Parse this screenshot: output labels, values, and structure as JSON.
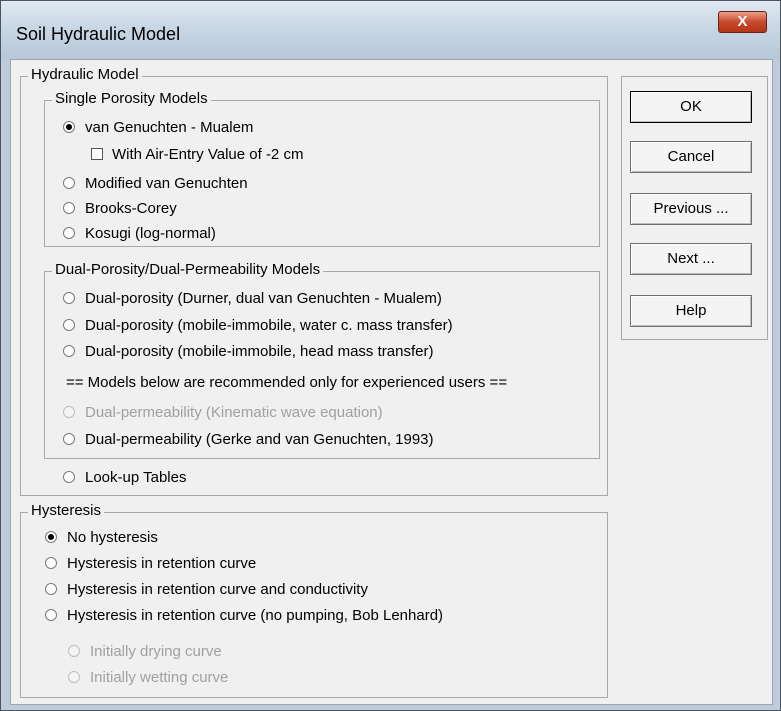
{
  "window": {
    "title": "Soil Hydraulic Model",
    "close_label": "X"
  },
  "hydraulic": {
    "label": "Hydraulic Model",
    "single": {
      "label": "Single Porosity Models",
      "vg": "van Genuchten - Mualem",
      "air_entry": "With Air-Entry Value of -2 cm",
      "modified": "Modified van Genuchten",
      "brooks": "Brooks-Corey",
      "kosugi": "Kosugi (log-normal)"
    },
    "dual": {
      "label": "Dual-Porosity/Dual-Permeability Models",
      "durner": "Dual-porosity (Durner, dual van Genuchten - Mualem)",
      "mim_water": "Dual-porosity (mobile-immobile, water c. mass transfer)",
      "mim_head": "Dual-porosity (mobile-immobile, head mass transfer)",
      "note": "== Models below are recommended only for experienced users ==",
      "kinematic": "Dual-permeability (Kinematic wave equation)",
      "gerke": "Dual-permeability (Gerke and van Genuchten, 1993)"
    },
    "lookup": "Look-up Tables"
  },
  "hysteresis": {
    "label": "Hysteresis",
    "none": "No hysteresis",
    "retention": "Hysteresis in retention curve",
    "retention_cond": "Hysteresis in retention curve and conductivity",
    "no_pumping": "Hysteresis in retention curve (no pumping, Bob Lenhard)",
    "drying": "Initially drying curve",
    "wetting": "Initially wetting curve"
  },
  "buttons": {
    "ok": "OK",
    "cancel": "Cancel",
    "previous": "Previous ...",
    "next": "Next ...",
    "help": "Help"
  }
}
